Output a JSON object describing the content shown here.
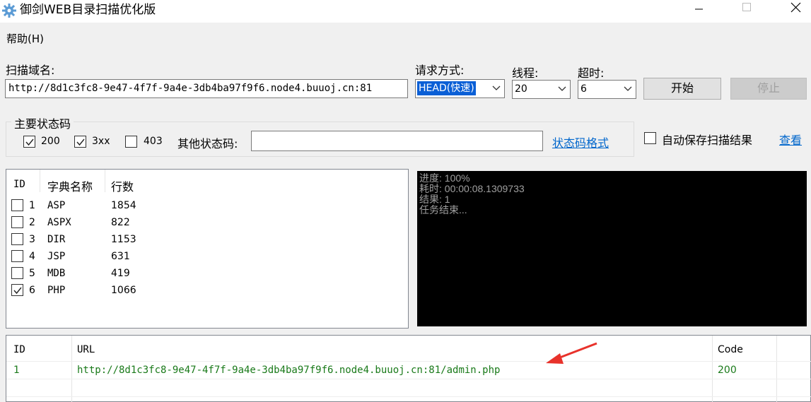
{
  "window": {
    "title": "御剑WEB目录扫描优化版",
    "icon": "gear-icon"
  },
  "menu": {
    "help": "帮助(H)"
  },
  "form": {
    "domain_label": "扫描域名:",
    "domain_value": "http://8d1c3fc8-9e47-4f7f-9a4e-3db4ba97f9f6.node4.buuoj.cn:81",
    "method_label": "请求方式:",
    "method_value": "HEAD(快速)",
    "threads_label": "线程:",
    "threads_value": "20",
    "timeout_label": "超时:",
    "timeout_value": "6",
    "start_label": "开始",
    "stop_label": "停止"
  },
  "status_codes": {
    "group_label": "主要状态码",
    "code_200": "200",
    "code_3xx": "3xx",
    "code_403": "403",
    "code_200_checked": true,
    "code_3xx_checked": true,
    "code_403_checked": false,
    "other_label": "其他状态码:",
    "other_value": "",
    "format_link": "状态码格式"
  },
  "autosave": {
    "label": "自动保存扫描结果",
    "checked": false,
    "view_link": "查看"
  },
  "dictionary": {
    "headers": [
      "ID",
      "字典名称",
      "行数"
    ],
    "rows": [
      {
        "id": "1",
        "name": "ASP",
        "lines": "1854",
        "checked": false
      },
      {
        "id": "2",
        "name": "ASPX",
        "lines": "822",
        "checked": false
      },
      {
        "id": "3",
        "name": "DIR",
        "lines": "1153",
        "checked": false
      },
      {
        "id": "4",
        "name": "JSP",
        "lines": "631",
        "checked": false
      },
      {
        "id": "5",
        "name": "MDB",
        "lines": "419",
        "checked": false
      },
      {
        "id": "6",
        "name": "PHP",
        "lines": "1066",
        "checked": true
      }
    ]
  },
  "console": {
    "lines": [
      "进度: 100%",
      "耗时: 00:00:08.1309733",
      "结果: 1",
      "任务结束..."
    ]
  },
  "results": {
    "headers": [
      "ID",
      "URL",
      "Code"
    ],
    "rows": [
      {
        "id": "1",
        "url": "http://8d1c3fc8-9e47-4f7f-9a4e-3db4ba97f9f6.node4.buuoj.cn:81/admin.php",
        "code": "200"
      }
    ],
    "row_color": "#1a7a1a"
  },
  "annotation": {
    "arrow_color": "#e8322b"
  }
}
